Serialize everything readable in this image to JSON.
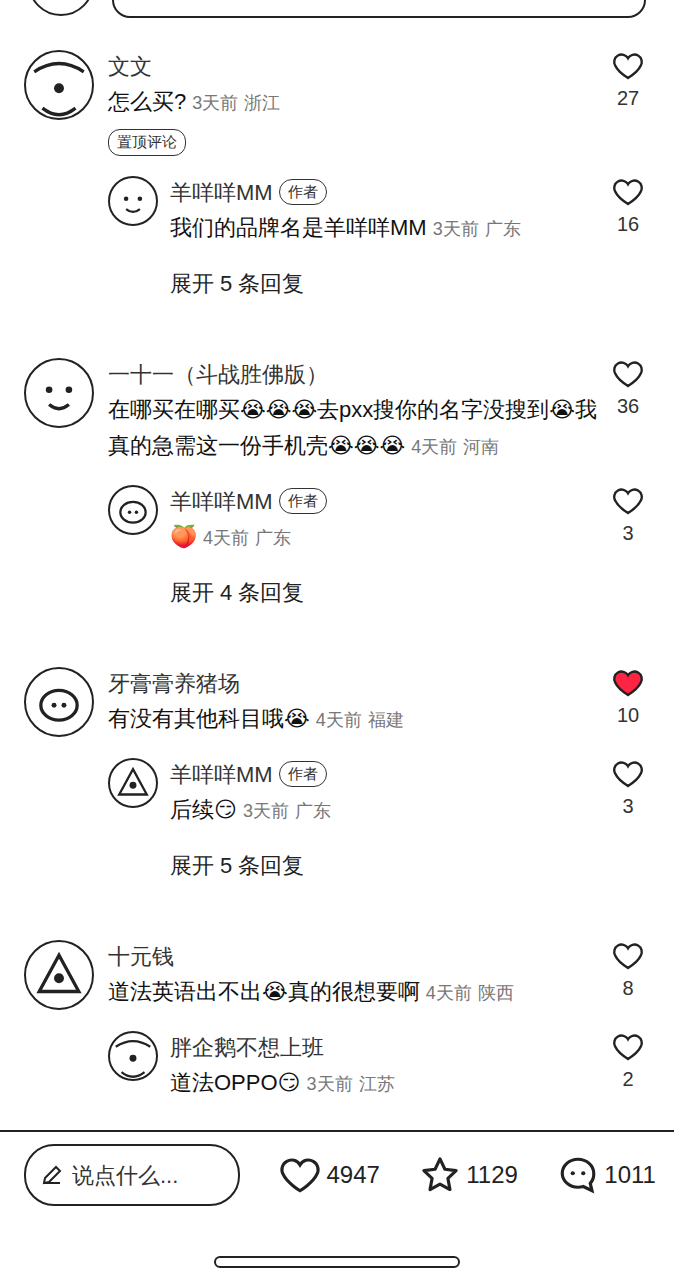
{
  "comments": [
    {
      "author": "文文",
      "text": "怎么买?",
      "time": "3天前",
      "location": "浙江",
      "likes": "27",
      "liked": false,
      "tag": "置顶评论",
      "reply": {
        "author": "羊咩咩MM",
        "badge": "作者",
        "text": "我们的品牌名是羊咩咩MM",
        "time": "3天前",
        "location": "广东",
        "likes": "16",
        "liked": false
      },
      "expand": "展开 5 条回复"
    },
    {
      "author": "一十一（斗战胜佛版）",
      "text": "在哪买在哪买😭😭😭去pxx搜你的名字没搜到😭我真的急需这一份手机壳😭😭😭",
      "time": "4天前",
      "location": "河南",
      "likes": "36",
      "liked": false,
      "tag": "",
      "reply": {
        "author": "羊咩咩MM",
        "badge": "作者",
        "text": "🍑",
        "time": "4天前",
        "location": "广东",
        "likes": "3",
        "liked": false
      },
      "expand": "展开 4 条回复"
    },
    {
      "author": "牙膏膏养猪场",
      "text": "有没有其他科目哦😭",
      "time": "4天前",
      "location": "福建",
      "likes": "10",
      "liked": true,
      "tag": "",
      "reply": {
        "author": "羊咩咩MM",
        "badge": "作者",
        "text": "后续😏",
        "time": "3天前",
        "location": "广东",
        "likes": "3",
        "liked": false
      },
      "expand": "展开 5 条回复"
    },
    {
      "author": "十元钱",
      "text": "道法英语出不出😭真的很想要啊",
      "time": "4天前",
      "location": "陕西",
      "likes": "8",
      "liked": false,
      "tag": "",
      "reply": {
        "author": "胖企鹅不想上班",
        "badge": "",
        "text": "道法OPPO😏",
        "time": "3天前",
        "location": "江苏",
        "likes": "2",
        "liked": false
      },
      "expand": ""
    }
  ],
  "footer": {
    "placeholder": "说点什么...",
    "likes": "4947",
    "stars": "1129",
    "comments": "1011"
  }
}
